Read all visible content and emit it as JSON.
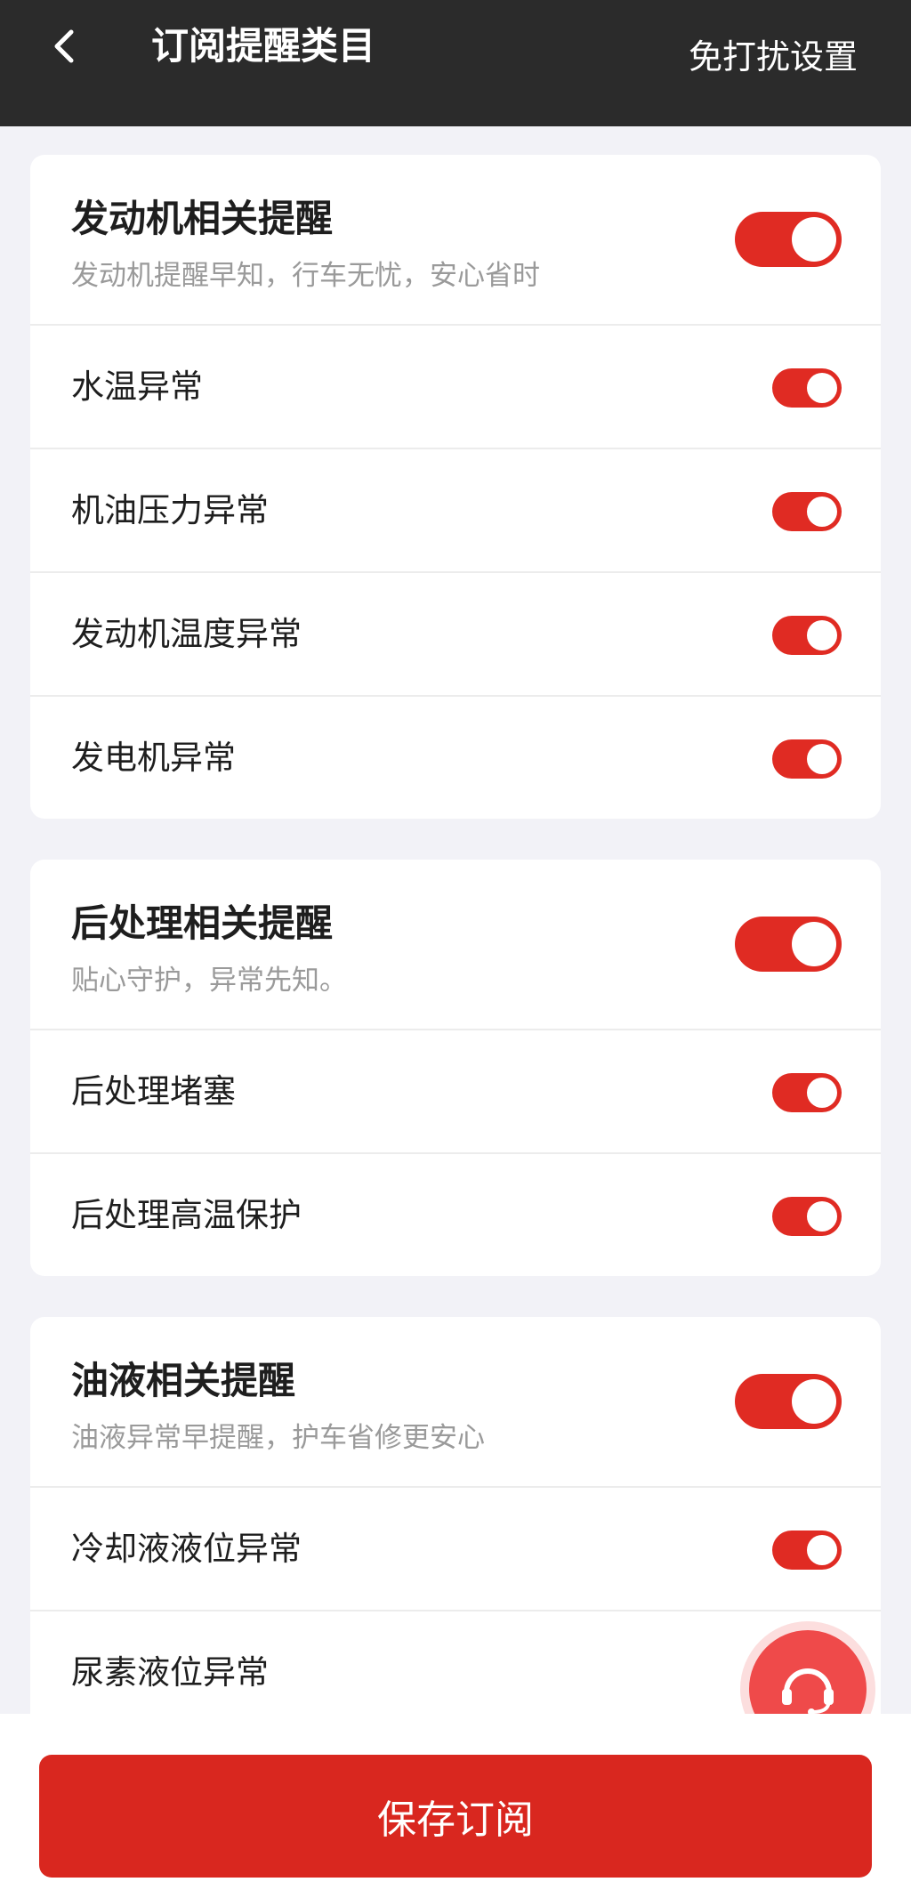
{
  "header": {
    "title": "订阅提醒类目",
    "action_label": "免打扰设置"
  },
  "colors": {
    "accent": "#e02b23",
    "header_bg": "#2b2b2b",
    "page_bg": "#f2f2f7"
  },
  "groups": [
    {
      "title": "发动机相关提醒",
      "subtitle": "发动机提醒早知，行车无忧，安心省时",
      "enabled": true,
      "items": [
        {
          "label": "水温异常",
          "enabled": true
        },
        {
          "label": "机油压力异常",
          "enabled": true
        },
        {
          "label": "发动机温度异常",
          "enabled": true
        },
        {
          "label": "发电机异常",
          "enabled": true
        }
      ]
    },
    {
      "title": "后处理相关提醒",
      "subtitle": "贴心守护，异常先知。",
      "enabled": true,
      "items": [
        {
          "label": "后处理堵塞",
          "enabled": true
        },
        {
          "label": "后处理高温保护",
          "enabled": true
        }
      ]
    },
    {
      "title": "油液相关提醒",
      "subtitle": "油液异常早提醒，护车省修更安心",
      "enabled": true,
      "items": [
        {
          "label": "冷却液液位异常",
          "enabled": true
        },
        {
          "label": "尿素液位异常",
          "enabled": true
        }
      ]
    }
  ],
  "footer": {
    "save_label": "保存订阅"
  },
  "icons": {
    "back": "chevron-left-icon",
    "support": "headset-icon"
  }
}
